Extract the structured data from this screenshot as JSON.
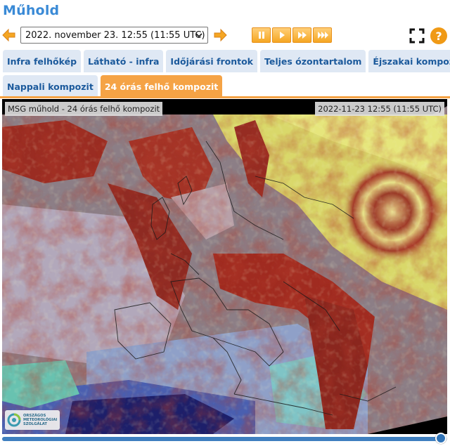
{
  "page": {
    "title": "Műhold"
  },
  "controls": {
    "prev_icon": "arrow-left-icon",
    "next_icon": "arrow-right-icon",
    "time_value": "2022. november 23. 12:55 (11:55  UTC)",
    "play_buttons": [
      "pause-icon",
      "play-icon",
      "fast-forward-icon",
      "faster-forward-icon"
    ],
    "fullscreen_icon": "fullscreen-icon",
    "help_label": "?"
  },
  "tabs": {
    "row1": [
      {
        "label": "Infra felhőkép"
      },
      {
        "label": "Látható - infra"
      },
      {
        "label": "Időjárási frontok"
      },
      {
        "label": "Teljes ózontartalom"
      },
      {
        "label": "Éjszakai kompozit"
      }
    ],
    "row2": [
      {
        "label": "Nappali kompozit"
      },
      {
        "label": "24 órás felhő kompozit",
        "active": true
      }
    ]
  },
  "viewer": {
    "caption": "MSG műhold - 24 órás felhő kompozit",
    "timestamp": "2022-11-23 12:55 (11:55 UTC)",
    "logo_text": [
      "ORSZÁGOS",
      "METEOROLÓGIAI",
      "SZOLGÁLAT"
    ]
  },
  "timeline": {
    "progress_fraction": 0.985
  },
  "colors": {
    "accent": "#f5a345",
    "title_blue": "#3a8ad6",
    "tab_bg": "#dfe8f4",
    "tab_text": "#1c5a9c"
  }
}
